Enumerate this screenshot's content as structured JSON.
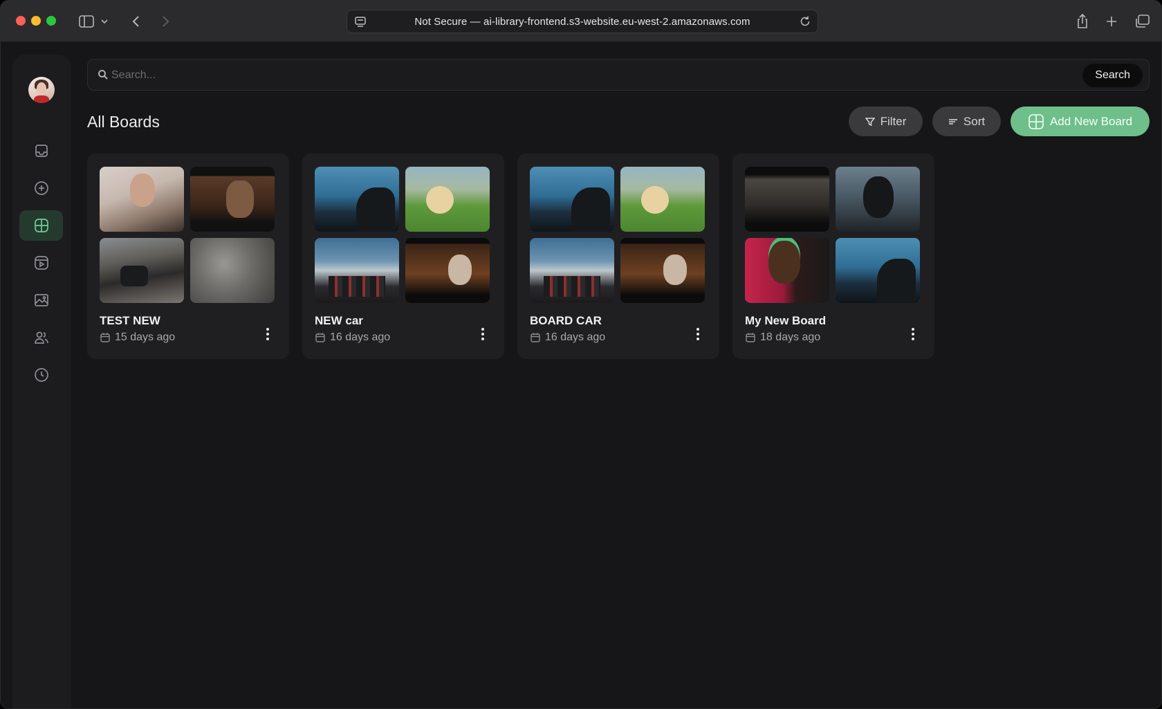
{
  "browser": {
    "url_text": "Not Secure — ai-library-frontend.s3-website.eu-west-2.amazonaws.com"
  },
  "sidebar": {
    "items": [
      {
        "name": "inbox",
        "icon": "inbox-icon",
        "active": false
      },
      {
        "name": "create",
        "icon": "plus-circle-icon",
        "active": false
      },
      {
        "name": "boards",
        "icon": "boards-grid-icon",
        "active": true
      },
      {
        "name": "videos",
        "icon": "video-icon",
        "active": false
      },
      {
        "name": "images",
        "icon": "image-icon",
        "active": false
      },
      {
        "name": "users",
        "icon": "users-icon",
        "active": false
      },
      {
        "name": "history",
        "icon": "clock-icon",
        "active": false
      }
    ]
  },
  "search": {
    "placeholder": "Search...",
    "button_label": "Search"
  },
  "page": {
    "title": "All Boards",
    "filter_label": "Filter",
    "sort_label": "Sort",
    "add_label": "Add New Board"
  },
  "colors": {
    "accent": "#6fbf8a",
    "background": "#161618",
    "card": "#1f1f21"
  },
  "boards": [
    {
      "name": "TEST NEW",
      "date": "15 days ago"
    },
    {
      "name": "NEW car",
      "date": "16 days ago"
    },
    {
      "name": "BOARD CAR",
      "date": "16 days ago"
    },
    {
      "name": "My New Board",
      "date": "18 days ago"
    }
  ]
}
